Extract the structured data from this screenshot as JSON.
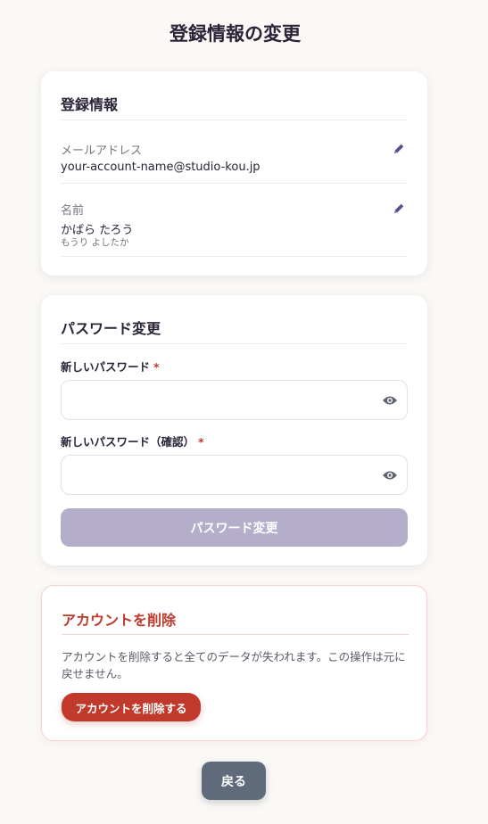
{
  "page": {
    "title": "登録情報の変更"
  },
  "profile": {
    "title": "登録情報",
    "email_label": "メールアドレス",
    "email_value": "your-account-name@studio-kou.jp",
    "name_label": "名前",
    "name_value": "かばら たろう",
    "name_kana": "もうり よしたか",
    "edit_icon": "pencil-icon"
  },
  "password": {
    "title": "パスワード変更",
    "new_label": "新しいパスワード",
    "confirm_label": "新しいパスワード（確認）",
    "required_mark": "*",
    "toggle_icon": "eye-icon",
    "submit_label": "パスワード変更",
    "new_value": "",
    "confirm_value": ""
  },
  "delete": {
    "title": "アカウントを削除",
    "warning": "アカウントを削除すると全てのデータが失われます。この操作は元に戻せません。",
    "button_label": "アカウントを削除する"
  },
  "footer": {
    "back_label": "戻る"
  },
  "colors": {
    "background": "#fbf9f6",
    "accent": "#5b4e8c",
    "disabled_button": "#b5aecb",
    "danger": "#c0392b",
    "back_button": "#5f6b7a"
  }
}
